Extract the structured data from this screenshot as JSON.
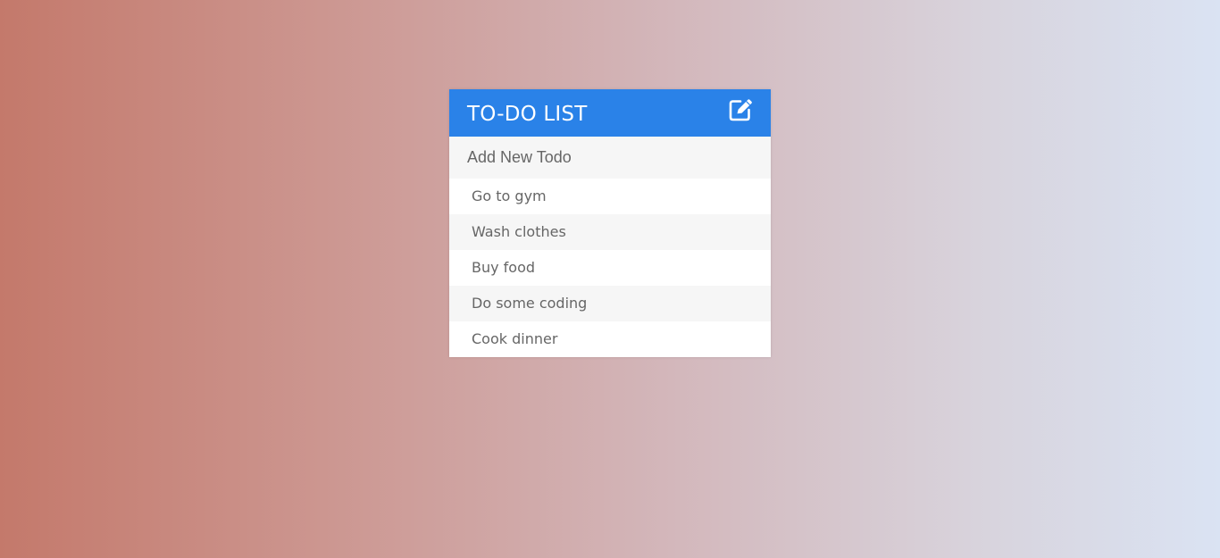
{
  "header": {
    "title": "TO-DO LIST",
    "edit_icon": "edit-pencil-square-icon"
  },
  "add_todo": {
    "placeholder": "Add New Todo",
    "value": ""
  },
  "todos": [
    {
      "text": "Go to gym"
    },
    {
      "text": "Wash clothes"
    },
    {
      "text": "Buy food"
    },
    {
      "text": "Do some coding"
    },
    {
      "text": "Cook dinner"
    }
  ],
  "colors": {
    "accent": "#2a82e8",
    "header_text": "#ffffff",
    "item_text": "#666666",
    "item_alt_background": "#f6f6f6"
  }
}
